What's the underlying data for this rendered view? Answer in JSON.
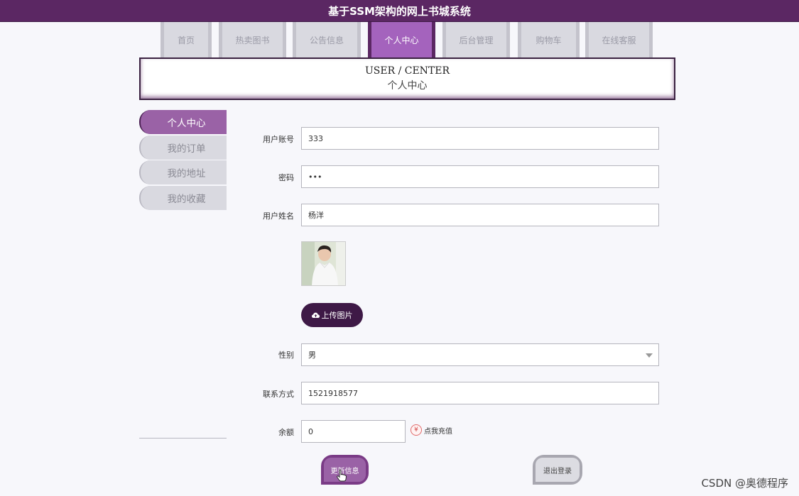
{
  "app": {
    "title": "基于SSM架构的网上书城系统"
  },
  "nav": {
    "tabs": [
      {
        "label": "首页"
      },
      {
        "label": "热卖图书"
      },
      {
        "label": "公告信息"
      },
      {
        "label": "个人中心"
      },
      {
        "label": "后台管理"
      },
      {
        "label": "购物车"
      },
      {
        "label": "在线客服"
      }
    ],
    "active_index": 3
  },
  "header": {
    "en": "USER / CENTER",
    "zh": "个人中心"
  },
  "sidebar": {
    "items": [
      {
        "label": "个人中心"
      },
      {
        "label": "我的订单"
      },
      {
        "label": "我的地址"
      },
      {
        "label": "我的收藏"
      }
    ]
  },
  "form": {
    "account": {
      "label": "用户账号",
      "value": "333"
    },
    "password": {
      "label": "密码",
      "value": "•••"
    },
    "name": {
      "label": "用户姓名",
      "value": "杨洋"
    },
    "upload_label": "上传图片",
    "gender": {
      "label": "性别",
      "value": "男"
    },
    "contact": {
      "label": "联系方式",
      "value": "1521918577"
    },
    "balance": {
      "label": "余额",
      "value": "0",
      "recharge_label": "点我充值",
      "recharge_icon": "¥"
    },
    "update_label": "更新信息",
    "logout_label": "退出登录"
  },
  "watermark": "CSDN @奥德程序",
  "colors": {
    "topbar": "#5b2763",
    "accent": "#9a62a6",
    "active_tab": "#a463bd"
  }
}
